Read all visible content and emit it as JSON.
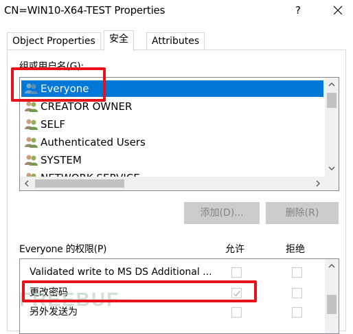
{
  "window": {
    "title": "CN=WIN10-X64-TEST Properties",
    "help_label": "?",
    "close_icon": "close-icon"
  },
  "tabs": [
    {
      "label": "Object Properties",
      "active": false
    },
    {
      "label": "安全",
      "active": true
    },
    {
      "label": "Attributes",
      "active": false
    }
  ],
  "security": {
    "group_label": "组或用户名(G):",
    "principals": [
      {
        "name": "Everyone",
        "selected": true,
        "icon": "users-icon"
      },
      {
        "name": "CREATOR OWNER",
        "selected": false,
        "icon": "users-icon"
      },
      {
        "name": "SELF",
        "selected": false,
        "icon": "users-icon"
      },
      {
        "name": "Authenticated Users",
        "selected": false,
        "icon": "users-icon"
      },
      {
        "name": "SYSTEM",
        "selected": false,
        "icon": "users-icon"
      },
      {
        "name": "NETWORK SERVICE",
        "selected": false,
        "icon": "users-icon"
      }
    ],
    "add_button": "添加(D)...",
    "remove_button": "删除(R)",
    "perm_label": "Everyone 的权限(P)",
    "col_allow": "允许",
    "col_deny": "拒绝",
    "permissions": [
      {
        "name": "Validated write to MS DS Additional ...",
        "allow": false,
        "deny": false
      },
      {
        "name": "更改密码",
        "allow": true,
        "deny": false
      },
      {
        "name": "另外发送为",
        "allow": false,
        "deny": false
      }
    ]
  },
  "watermark": "FREEBUF",
  "colors": {
    "selection": "#0078d7",
    "highlight_box": "#e8101a",
    "disabled_button": "#cccccc"
  }
}
